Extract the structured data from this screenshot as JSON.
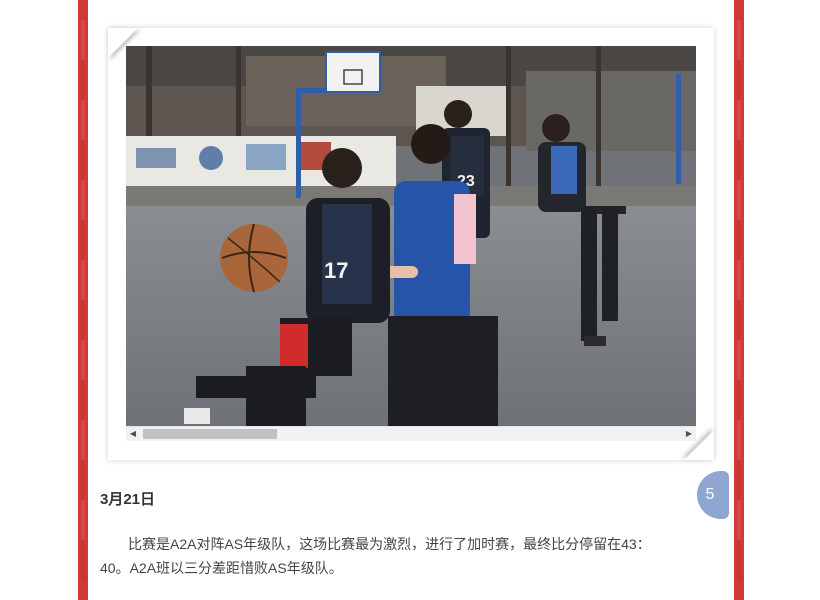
{
  "article": {
    "photo": {
      "jersey_numbers": [
        "17",
        "23"
      ],
      "scroll_left_icon": "arrow-left-icon",
      "scroll_right_icon": "arrow-right-icon",
      "scroll_left_glyph": "◀",
      "scroll_right_glyph": "▶"
    },
    "date_heading": "3月21日",
    "page_number": "5",
    "body": "比赛是A2A对阵AS年级队，这场比赛最为激烈，进行了加时赛，最终比分停留在43：40。A2A班以三分差距惜败AS年级队。"
  },
  "colors": {
    "border_red": "#d03a36",
    "badge_blue": "#8fa6d0",
    "heading_text": "#333333",
    "body_text": "#444444"
  }
}
